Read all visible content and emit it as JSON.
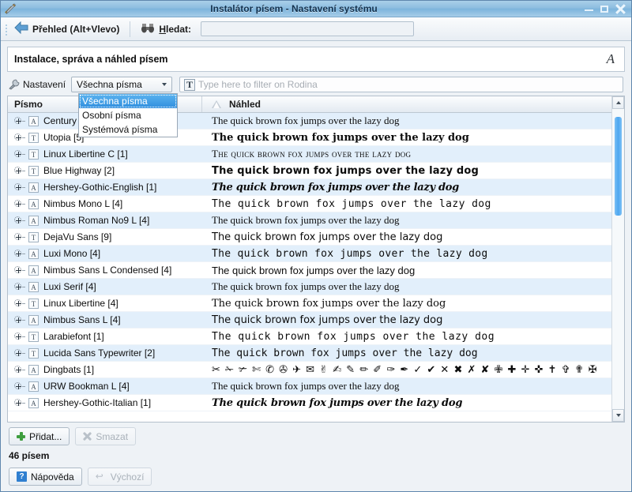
{
  "window": {
    "title": "Instalátor písem - Nastavení systému",
    "icon": "tools-icon",
    "controls": {
      "minimize": "–",
      "maximize": "□",
      "close": "✕"
    }
  },
  "toolbar": {
    "back_label": "Přehled (Alt+Vlevo)",
    "back_icon": "back-arrow-icon",
    "search_label": "Hledat:",
    "search_icon": "binoculars-icon",
    "search_value": "",
    "search_placeholder": ""
  },
  "description": {
    "text": "Instalace, správa a náhled písem",
    "icon": "italic-a-icon"
  },
  "filter": {
    "settings_label": "Nastavení",
    "settings_icon": "wrench-icon",
    "combo_value": "Všechna písma",
    "combo_options": [
      "Všechna písma",
      "Osobní písma",
      "Systémová písma"
    ],
    "combo_selected_index": 0,
    "field_icon": "text-filter-icon",
    "field_value": "",
    "field_placeholder": "Type here to filter on Rodina"
  },
  "table": {
    "columns": [
      "Písmo",
      "Náhled"
    ],
    "sort_icon": "sort-ascending-icon",
    "preview_sentence": "The quick brown fox jumps over the lazy dog",
    "rows": [
      {
        "name": "Century Sc",
        "type_badge": "A",
        "preview": "The quick brown fox jumps over the lazy dog",
        "style": "p-serif"
      },
      {
        "name": "Utopia [5]",
        "type_badge": "T",
        "preview": "The quick brown fox jumps over the lazy dog",
        "style": "p-serif2"
      },
      {
        "name": "Linux Libertine C [1]",
        "type_badge": "T",
        "preview": "The quick brown fox jumps over the lazy dog",
        "style": "p-smallcap"
      },
      {
        "name": "Blue Highway [2]",
        "type_badge": "T",
        "preview": "The quick brown fox jumps over the lazy dog",
        "style": "p-sansb"
      },
      {
        "name": "Hershey-Gothic-English [1]",
        "type_badge": "A",
        "preview": "The quick brown fox jumps over the lazy dog",
        "style": "p-gothic"
      },
      {
        "name": "Nimbus Mono L [4]",
        "type_badge": "A",
        "preview": "The quick brown fox jumps over the lazy dog",
        "style": "p-monolt"
      },
      {
        "name": "Nimbus Roman No9 L [4]",
        "type_badge": "A",
        "preview": "The quick brown fox jumps over the lazy dog",
        "style": "p-serif3"
      },
      {
        "name": "DejaVu Sans [9]",
        "type_badge": "T",
        "preview": "The quick brown fox jumps over the lazy dog",
        "style": "p-sans"
      },
      {
        "name": "Luxi Mono [4]",
        "type_badge": "A",
        "preview": "The quick brown fox jumps over the lazy dog",
        "style": "p-mono"
      },
      {
        "name": "Nimbus Sans L Condensed [4]",
        "type_badge": "A",
        "preview": "The quick brown fox jumps over the lazy dog",
        "style": "p-sanssm"
      },
      {
        "name": "Luxi Serif [4]",
        "type_badge": "A",
        "preview": "The quick brown fox jumps over the lazy dog",
        "style": "p-serif4"
      },
      {
        "name": "Linux Libertine [4]",
        "type_badge": "T",
        "preview": "The quick brown fox jumps over the lazy dog",
        "style": "p-serif5"
      },
      {
        "name": "Nimbus Sans L [4]",
        "type_badge": "A",
        "preview": "The quick brown fox jumps over the lazy dog",
        "style": "p-sans2"
      },
      {
        "name": "Larabiefont [1]",
        "type_badge": "T",
        "preview": "The quick brown fox jumps over the lazy dog",
        "style": "p-ghost"
      },
      {
        "name": "Lucida Sans Typewriter [2]",
        "type_badge": "T",
        "preview": "The quick brown fox jumps over the lazy dog",
        "style": "p-mono2"
      },
      {
        "name": "Dingbats [1]",
        "type_badge": "A",
        "preview": "✂ ✁ ✃ ✄ ✆ ✇ ✈ ✉ ✌ ✍ ✎ ✏ ✐ ✑ ✒ ✓ ✔ ✕ ✖ ✗ ✘ ✙ ✚ ✛ ✜ ✝ ✞ ✟ ✠",
        "style": "p-dingbat"
      },
      {
        "name": "URW Bookman L [4]",
        "type_badge": "A",
        "preview": "The quick brown fox jumps over the lazy dog",
        "style": "p-bookman"
      },
      {
        "name": "Hershey-Gothic-Italian [1]",
        "type_badge": "A",
        "preview": "The quick brown fox jumps over the lazy dog",
        "style": "p-gothic2"
      }
    ]
  },
  "actions": {
    "add_label": "Přidat...",
    "add_icon": "plus-icon",
    "delete_label": "Smazat",
    "delete_icon": "x-icon",
    "delete_enabled": false,
    "status_text": "46 písem",
    "help_label": "Nápověda",
    "help_icon": "help-icon",
    "defaults_label": "Výchozí",
    "defaults_icon": "undo-icon",
    "defaults_enabled": false
  },
  "scrollbar": {
    "up_icon": "scroll-up-icon",
    "down_icon": "scroll-down-icon"
  }
}
